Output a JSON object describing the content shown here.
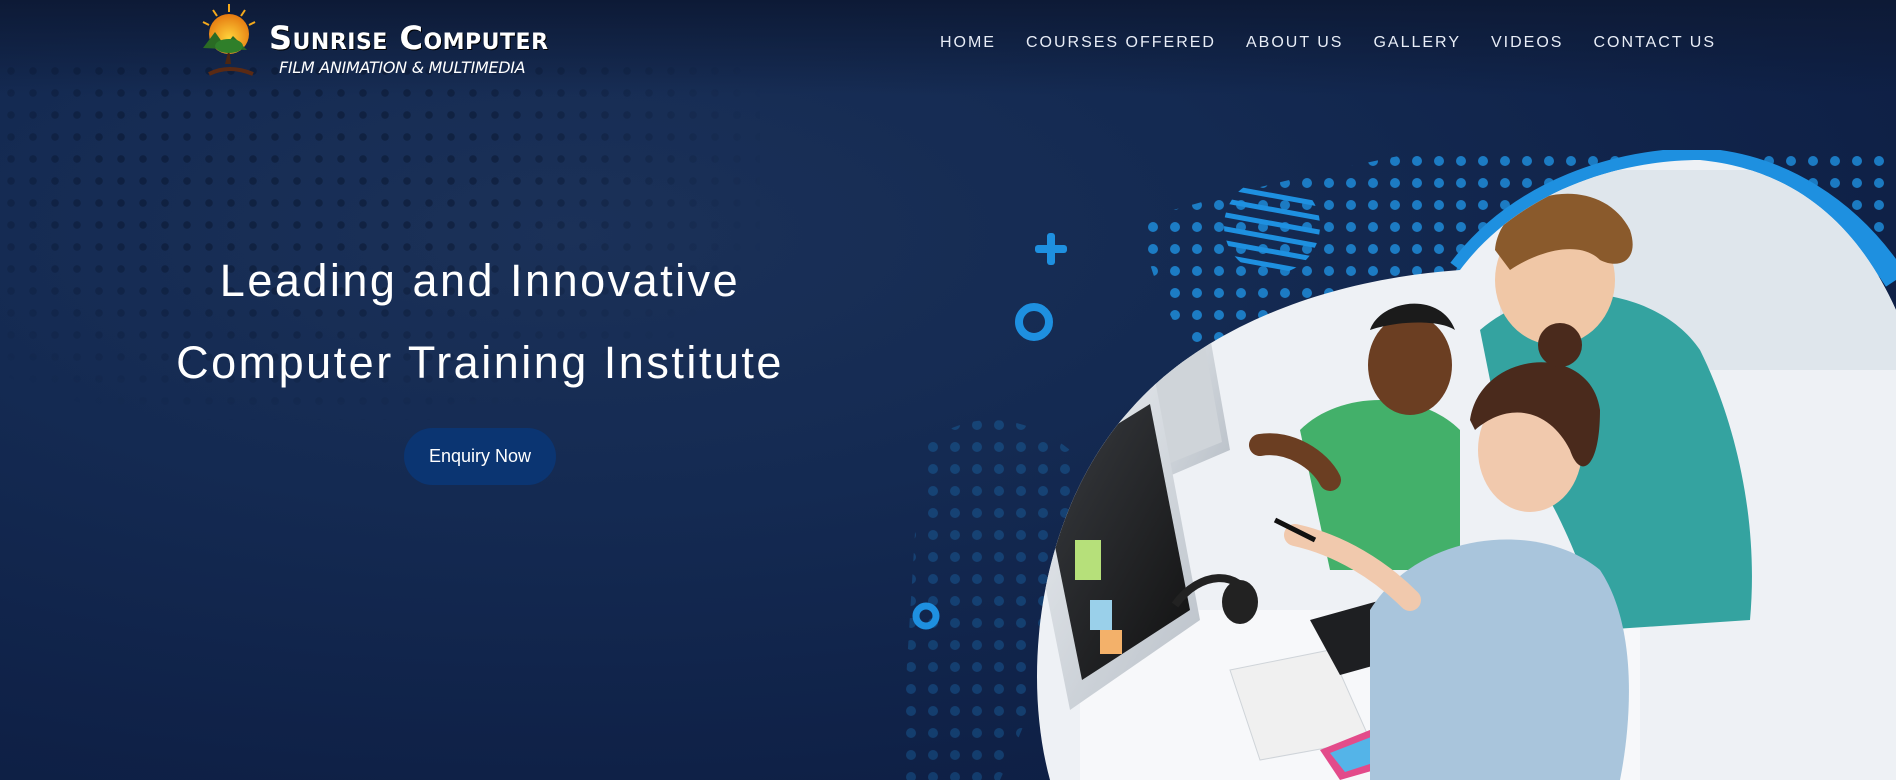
{
  "brand": {
    "name": "Sunrise Computer",
    "tagline": "FILM ANIMATION & MULTIMEDIA",
    "logo_icon": "sunrise-tree-logo"
  },
  "nav": {
    "items": [
      {
        "label": "HOME"
      },
      {
        "label": "COURSES OFFERED"
      },
      {
        "label": "ABOUT US"
      },
      {
        "label": "GALLERY"
      },
      {
        "label": "VIDEOS"
      },
      {
        "label": "CONTACT US"
      }
    ]
  },
  "hero": {
    "line1": "Leading and Innovative",
    "line2": "Computer Training Institute",
    "cta_label": "Enquiry Now",
    "image": "students-at-computer-photo"
  },
  "colors": {
    "background": "#132a52",
    "accent": "#1e90e0",
    "button": "#0b3572"
  }
}
